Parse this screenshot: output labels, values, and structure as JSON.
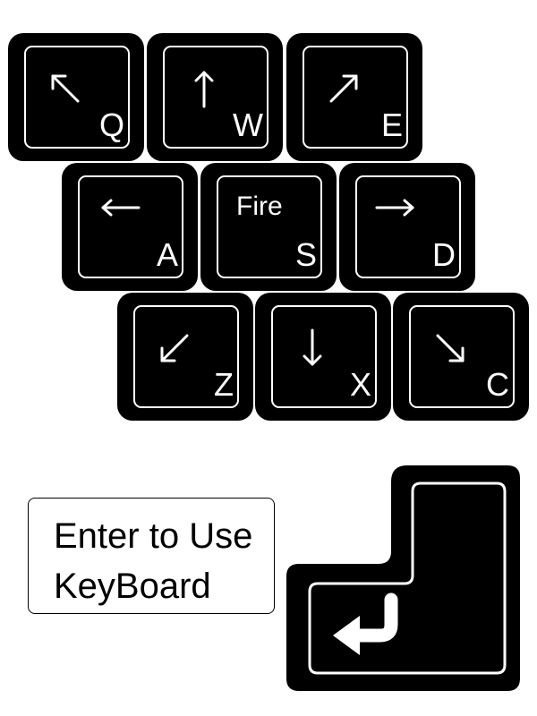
{
  "colors": {
    "key_background": "#000000",
    "key_outline": "#ffffff",
    "page_background": "#ffffff"
  },
  "keys": [
    {
      "letter": "Q",
      "action": "",
      "icon": "arrow-up-left-icon"
    },
    {
      "letter": "W",
      "action": "",
      "icon": "arrow-up-icon"
    },
    {
      "letter": "E",
      "action": "",
      "icon": "arrow-up-right-icon"
    },
    {
      "letter": "A",
      "action": "",
      "icon": "arrow-left-icon"
    },
    {
      "letter": "S",
      "action": "Fire",
      "icon": ""
    },
    {
      "letter": "D",
      "action": "",
      "icon": "arrow-right-icon"
    },
    {
      "letter": "Z",
      "action": "",
      "icon": "arrow-down-left-icon"
    },
    {
      "letter": "X",
      "action": "",
      "icon": "arrow-down-icon"
    },
    {
      "letter": "C",
      "action": "",
      "icon": "arrow-down-right-icon"
    }
  ],
  "enter": {
    "label_line1": "Enter to Use",
    "label_line2": "KeyBoard",
    "icon": "enter-return-icon"
  }
}
